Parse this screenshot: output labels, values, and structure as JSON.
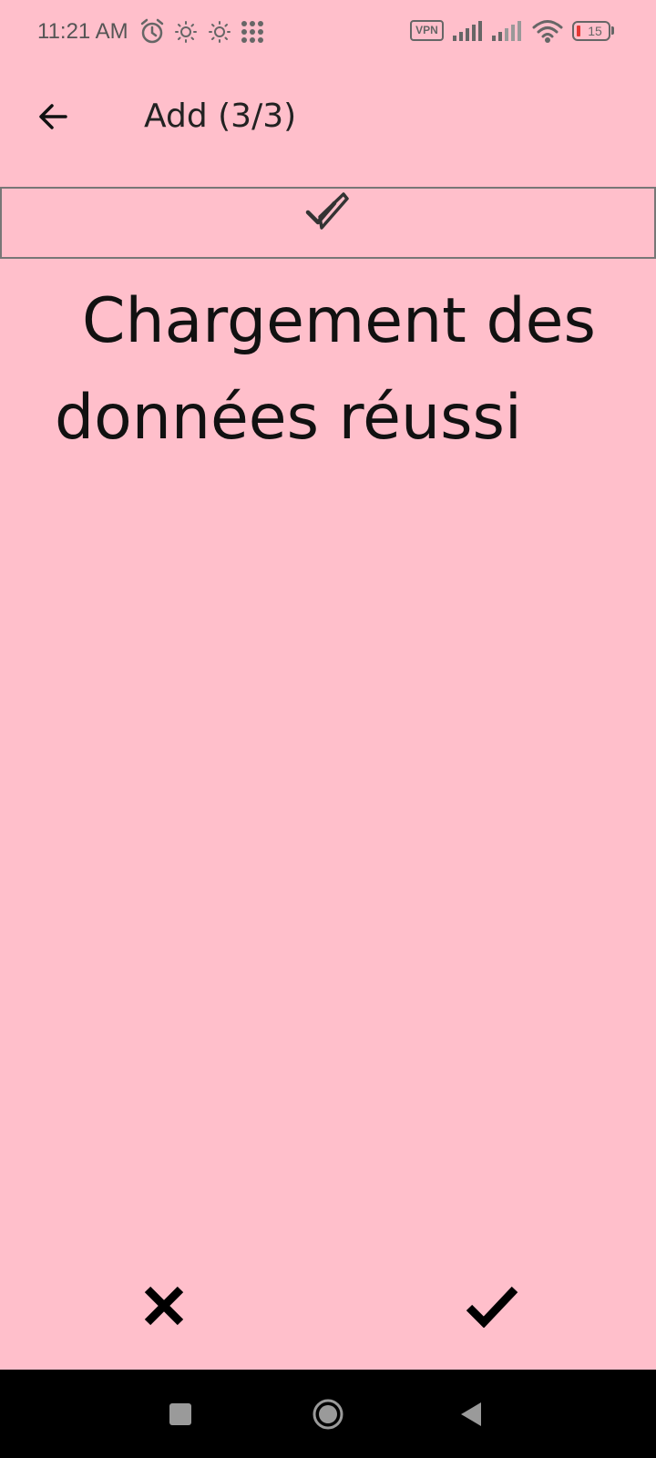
{
  "status_bar": {
    "time": "11:21 AM",
    "vpn_label": "VPN",
    "battery_level": "15",
    "battery_color": "#e53935",
    "icons": [
      "alarm-icon",
      "brightness-icon",
      "brightness-icon",
      "apps-grid-icon",
      "vpn-icon",
      "signal-icon",
      "signal-icon",
      "wifi-icon",
      "battery-icon"
    ]
  },
  "header": {
    "title": "Add (3/3)",
    "back_icon": "arrow-left-icon"
  },
  "check_bar": {
    "icon": "double-check-icon"
  },
  "main": {
    "message": "Chargement des données réussi"
  },
  "actions": {
    "cancel_icon": "close-icon",
    "confirm_icon": "check-icon"
  },
  "nav_bar": {
    "icons": [
      "recent-apps-icon",
      "home-icon",
      "back-icon"
    ]
  },
  "colors": {
    "background": "#ffbfcb",
    "nav_bar": "#000000"
  }
}
